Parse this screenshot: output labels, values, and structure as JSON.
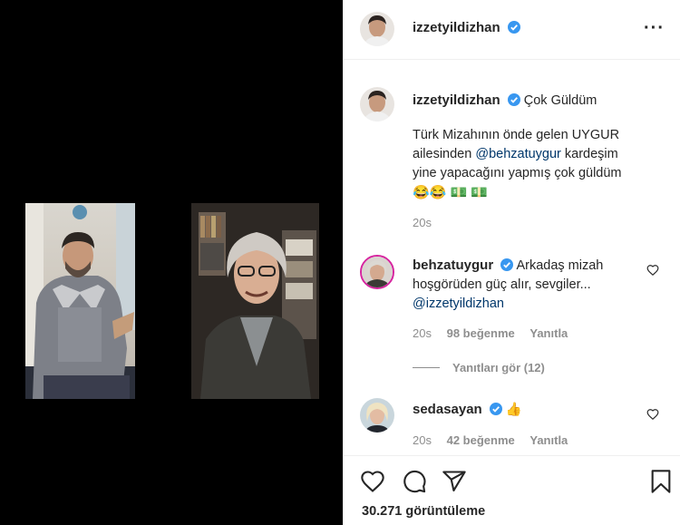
{
  "post": {
    "author": "izzetyildizhan",
    "caption_title": "Çok Güldüm",
    "caption_lines": [
      "Türk Mizahının önde gelen UYGUR",
      "ailesinden",
      "@behzatuygur",
      "kardeşim",
      "yine yapacağını yapmış çok güldüm"
    ],
    "caption_emoji": "😂😂 💵 💵",
    "time": "20s",
    "views": "30.271 görüntüleme"
  },
  "comments": [
    {
      "user": "behzatuygur",
      "text_line1": "Arkadaş mizah",
      "text_line2": "hoşgörüden güç alır, sevgiler...",
      "mention": "@izzetyildizhan",
      "time": "20s",
      "likes": "98 beğenme",
      "reply": "Yanıtla",
      "view_replies": "Yanıtları gör (12)"
    },
    {
      "user": "sedasayan",
      "emoji": "👍",
      "time": "20s",
      "likes": "42 beğenme",
      "reply": "Yanıtla"
    }
  ],
  "icons": {
    "more": "more-icon",
    "verified": "verified-icon",
    "like": "heart-icon",
    "comment": "comment-icon",
    "share": "share-icon",
    "save": "bookmark-icon"
  },
  "colors": {
    "verified": "#3897f0",
    "mention": "#00376b",
    "muted": "#8e8e8e"
  }
}
